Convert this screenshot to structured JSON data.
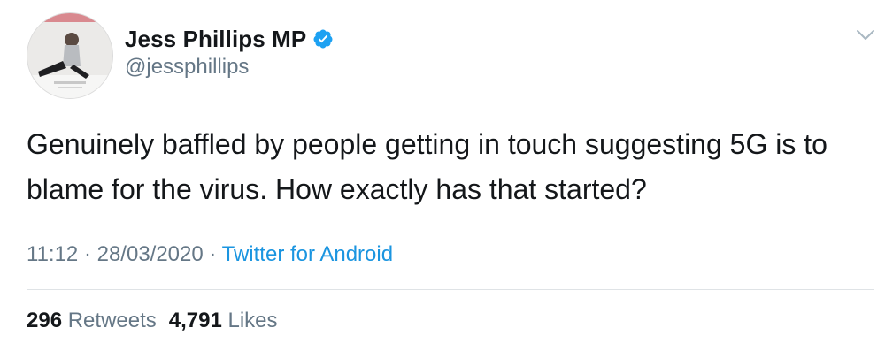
{
  "author": {
    "display_name": "Jess Phillips MP",
    "handle": "@jessphillips",
    "verified": true,
    "avatar_icon": "profile-photo-icon"
  },
  "tweet": {
    "text": "Genuinely baffled by people getting in touch suggesting 5G is to blame for the virus. How exactly has that started?"
  },
  "meta": {
    "time": "11:12",
    "separator": " · ",
    "date": "28/03/2020",
    "source": "Twitter for Android"
  },
  "stats": {
    "retweets_count": "296",
    "retweets_label": "Retweets",
    "likes_count": "4,791",
    "likes_label": "Likes"
  },
  "colors": {
    "link": "#1b95e0",
    "secondary_text": "#657786",
    "primary_text": "#14171a",
    "verified_badge": "#1da1f2"
  },
  "icons": {
    "verified": "verified-badge-icon",
    "menu": "chevron-down-icon"
  }
}
